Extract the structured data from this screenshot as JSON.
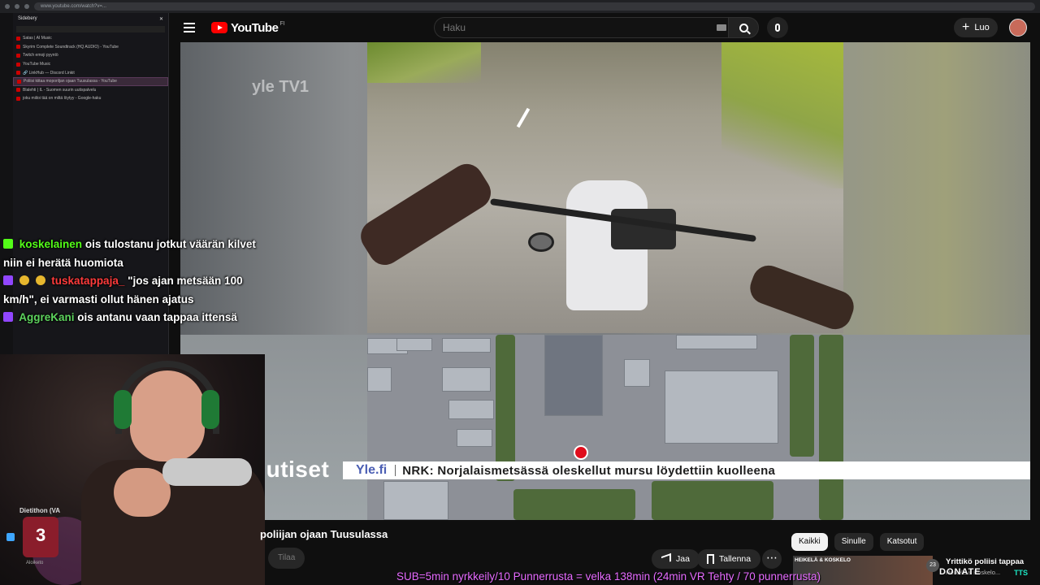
{
  "browser": {
    "url": "www.youtube.com/watch?v=..."
  },
  "sidebar": {
    "title": "Sidebery",
    "items": [
      {
        "label": "Satas | AI Music"
      },
      {
        "label": "Skyrim Complete Soundtrack (HQ AUDIO) - YouTube"
      },
      {
        "label": "Twitch emoji pyyntö"
      },
      {
        "label": "YouTube Music"
      },
      {
        "label": "🔗 LinkHub — Discord Linkit"
      },
      {
        "label": "Poliisi kiitaa moporiljan ojaan Tuusulassa - YouTube",
        "active": true
      },
      {
        "label": "Blalehti | IL - Suomen suurin uutispalvelu"
      },
      {
        "label": "joku miiloi tää on miltä löytyy - Google-haku"
      }
    ]
  },
  "header": {
    "brand": "YouTube",
    "region": "FI",
    "search_placeholder": "Haku",
    "create_label": "Luo"
  },
  "player": {
    "channel_watermark": "yle TV1",
    "news_logo": "uutiset",
    "ticker_source": "Yle.fi",
    "ticker_text": "NRK: Norjalaismetsässä oleskellut mursu löydettiin kuolleena"
  },
  "chat": {
    "messages": [
      {
        "user": "koskelainen",
        "text": "ois tulostanu jotkut väärän kilvet niin ei herätä huomiota",
        "color": "#53fc18"
      },
      {
        "user": "tuskatappaja_",
        "text": "\"jos ajan metsään 100 km/h\", ei varmasti ollut hänen ajatus",
        "color": "#ff3b3b"
      },
      {
        "user": "AggreKani",
        "text": "ois antanu vaan tappaa ittensä",
        "color": "#5dd35d"
      }
    ]
  },
  "widget": {
    "label": "Dietithon (VA",
    "number": "3",
    "sub": "Aloiketo"
  },
  "video_info": {
    "title": "poliijan ojaan Tuusulassa",
    "subscribe_label": "Tilaa",
    "share_label": "Jaa",
    "save_label": "Tallenna",
    "more_label": "⋯"
  },
  "chips": [
    {
      "label": "Kaikki",
      "active": true
    },
    {
      "label": "Sinulle",
      "active": false
    },
    {
      "label": "Katsotut",
      "active": false
    }
  ],
  "recommendation": {
    "thumb_label": "HEIKELÄ & KOSKELO",
    "count": "23",
    "title": "Yrittikö poliisi tappaa",
    "sub": "Heikelä & Koskelo..."
  },
  "overlay": {
    "donate": "DONATE",
    "donate_suffix": "TTS",
    "goal_text": "SUB=5min nyrkkeily/10 Punnerrusta = velka 138min (24min VR Tehty / 70 punnerrusta)"
  }
}
